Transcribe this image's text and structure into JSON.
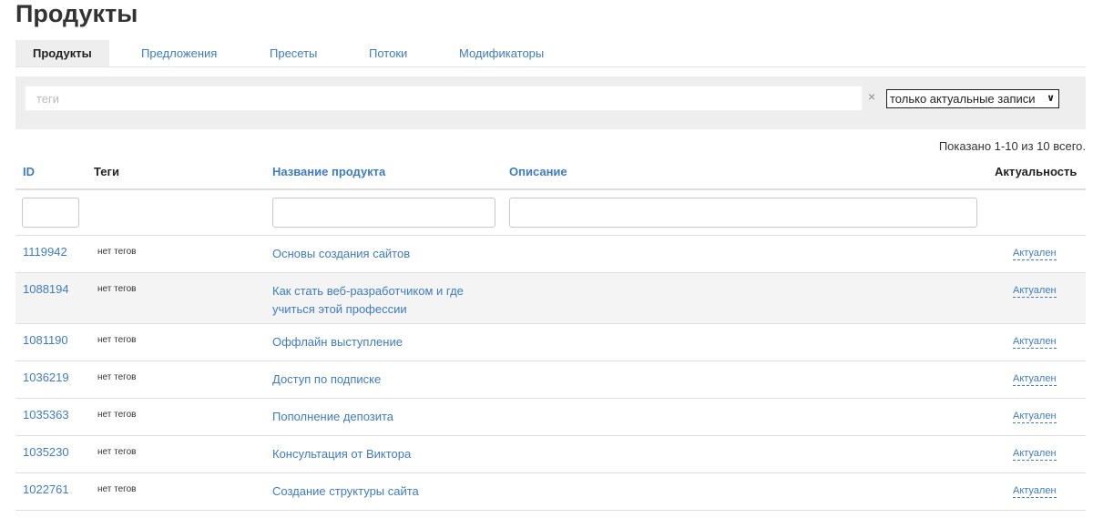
{
  "page": {
    "title": "Продукты"
  },
  "tabs": [
    {
      "label": "Продукты",
      "active": true
    },
    {
      "label": "Предложения",
      "active": false
    },
    {
      "label": "Пресеты",
      "active": false
    },
    {
      "label": "Потоки",
      "active": false
    },
    {
      "label": "Модификаторы",
      "active": false
    }
  ],
  "filter": {
    "tags_placeholder": "теги",
    "clear_symbol": "×",
    "select_value": "только актуальные записи"
  },
  "summary": "Показано 1-10 из 10 всего.",
  "table": {
    "headers": {
      "id": "ID",
      "tags": "Теги",
      "name": "Название продукта",
      "description": "Описание",
      "actual": "Актуальность"
    },
    "rows": [
      {
        "id": "1119942",
        "tags": "нет тегов",
        "name": "Основы создания сайтов",
        "description": "",
        "actual": "Актуален"
      },
      {
        "id": "1088194",
        "tags": "нет тегов",
        "name": "Как стать веб-разработчиком и где учиться этой профессии",
        "description": "",
        "actual": "Актуален"
      },
      {
        "id": "1081190",
        "tags": "нет тегов",
        "name": "Оффлайн выступление",
        "description": "",
        "actual": "Актуален"
      },
      {
        "id": "1036219",
        "tags": "нет тегов",
        "name": "Доступ по подписке",
        "description": "",
        "actual": "Актуален"
      },
      {
        "id": "1035363",
        "tags": "нет тегов",
        "name": "Пополнение депозита",
        "description": "",
        "actual": "Актуален"
      },
      {
        "id": "1035230",
        "tags": "нет тегов",
        "name": "Консультация от Виктора",
        "description": "",
        "actual": "Актуален"
      },
      {
        "id": "1022761",
        "tags": "нет тегов",
        "name": "Создание структуры сайта",
        "description": "",
        "actual": "Актуален"
      }
    ]
  },
  "colors": {
    "link": "#3f7cbf",
    "stripe": "#f4f4f4",
    "filter_bg": "#eeeeee"
  },
  "icons": {
    "select_chevron": "chevron-down-icon",
    "clear": "close-icon"
  }
}
